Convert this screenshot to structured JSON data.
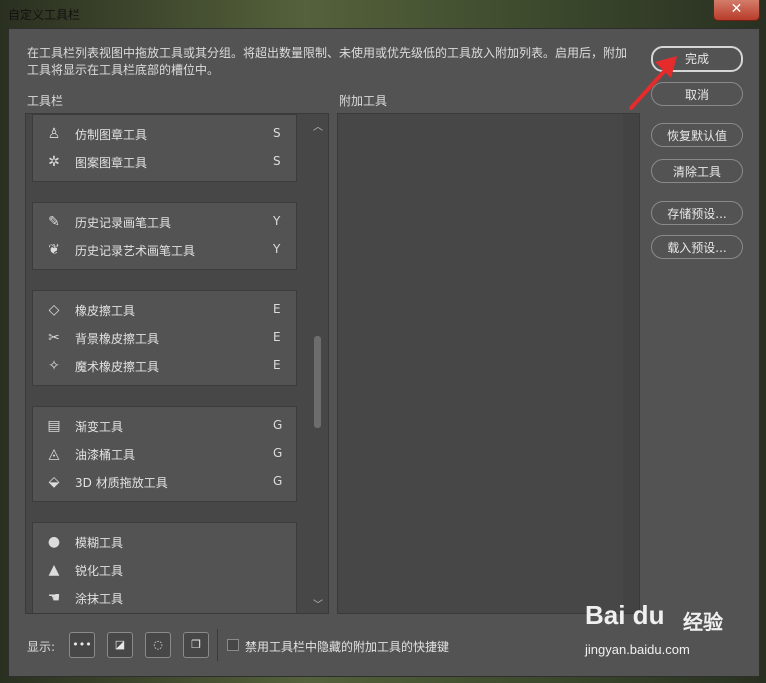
{
  "window": {
    "title": "自定义工具栏",
    "close_glyph": "✕"
  },
  "description": "在工具栏列表视图中拖放工具或其分组。将超出数量限制、未使用或优先级低的工具放入附加列表。启用后，附加工具将显示在工具栏底部的槽位中。",
  "labels": {
    "toolbar": "工具栏",
    "extra_tools": "附加工具"
  },
  "buttons": {
    "done": "完成",
    "cancel": "取消",
    "restore_defaults": "恢复默认值",
    "clear_tools": "清除工具",
    "save_preset": "存储预设...",
    "load_preset": "载入预设..."
  },
  "tool_groups": [
    {
      "tools": [
        {
          "name": "仿制图章工具",
          "key": "S",
          "icon": "clone-stamp-icon"
        },
        {
          "name": "图案图章工具",
          "key": "S",
          "icon": "pattern-stamp-icon"
        }
      ]
    },
    {
      "tools": [
        {
          "name": "历史记录画笔工具",
          "key": "Y",
          "icon": "history-brush-icon"
        },
        {
          "name": "历史记录艺术画笔工具",
          "key": "Y",
          "icon": "art-history-brush-icon"
        }
      ]
    },
    {
      "tools": [
        {
          "name": "橡皮擦工具",
          "key": "E",
          "icon": "eraser-icon"
        },
        {
          "name": "背景橡皮擦工具",
          "key": "E",
          "icon": "background-eraser-icon"
        },
        {
          "name": "魔术橡皮擦工具",
          "key": "E",
          "icon": "magic-eraser-icon"
        }
      ]
    },
    {
      "tools": [
        {
          "name": "渐变工具",
          "key": "G",
          "icon": "gradient-icon"
        },
        {
          "name": "油漆桶工具",
          "key": "G",
          "icon": "paint-bucket-icon"
        },
        {
          "name": "3D 材质拖放工具",
          "key": "G",
          "icon": "3d-material-drop-icon"
        }
      ]
    },
    {
      "tools": [
        {
          "name": "模糊工具",
          "key": "",
          "icon": "blur-icon"
        },
        {
          "name": "锐化工具",
          "key": "",
          "icon": "sharpen-icon"
        },
        {
          "name": "涂抹工具",
          "key": "",
          "icon": "smudge-icon"
        }
      ]
    }
  ],
  "bottom": {
    "show_label": "显示:",
    "checkbox_label": "禁用工具栏中隐藏的附加工具的快捷键",
    "checkbox_checked": false
  },
  "watermark": {
    "logo": "Bai du",
    "cn": "经验",
    "url": "jingyan.baidu.com"
  }
}
